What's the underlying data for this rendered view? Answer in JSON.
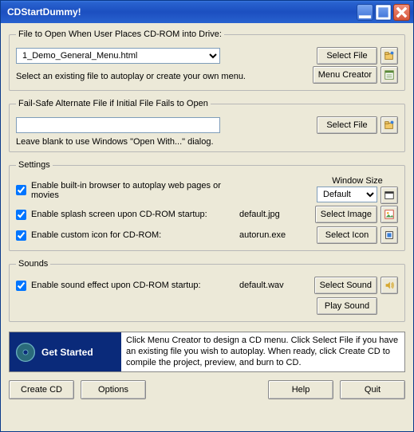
{
  "window": {
    "title": "CDStartDummy!"
  },
  "group_open": {
    "legend": "File to Open When User Places CD-ROM into Drive:",
    "dropdown_value": "1_Demo_General_Menu.html",
    "hint": "Select an existing file to autoplay or create your own menu.",
    "select_file": "Select File",
    "menu_creator": "Menu Creator"
  },
  "group_failsafe": {
    "legend": "Fail-Safe Alternate File if Initial File Fails to Open",
    "input_value": "",
    "hint": "Leave blank to use Windows \"Open With...\" dialog.",
    "select_file": "Select File"
  },
  "group_settings": {
    "legend": "Settings",
    "window_size_label": "Window Size",
    "window_size_value": "Default",
    "row1": {
      "label": "Enable built-in browser to autoplay web pages or movies",
      "checked": true
    },
    "row2": {
      "label": "Enable splash screen upon CD-ROM startup:",
      "value": "default.jpg",
      "checked": true,
      "btn": "Select Image"
    },
    "row3": {
      "label": "Enable custom icon for CD-ROM:",
      "value": "autorun.exe",
      "checked": true,
      "btn": "Select Icon"
    }
  },
  "group_sounds": {
    "legend": "Sounds",
    "row": {
      "label": "Enable sound effect upon CD-ROM startup:",
      "value": "default.wav",
      "checked": true
    },
    "select_sound": "Select Sound",
    "play_sound": "Play Sound"
  },
  "get_started": {
    "title": "Get Started",
    "text": "Click Menu Creator to design a CD menu. Click Select File if you have an existing file you wish to autoplay. When ready, click Create CD to compile the project, preview, and burn to CD."
  },
  "buttons": {
    "create_cd": "Create CD",
    "options": "Options",
    "help": "Help",
    "quit": "Quit"
  }
}
